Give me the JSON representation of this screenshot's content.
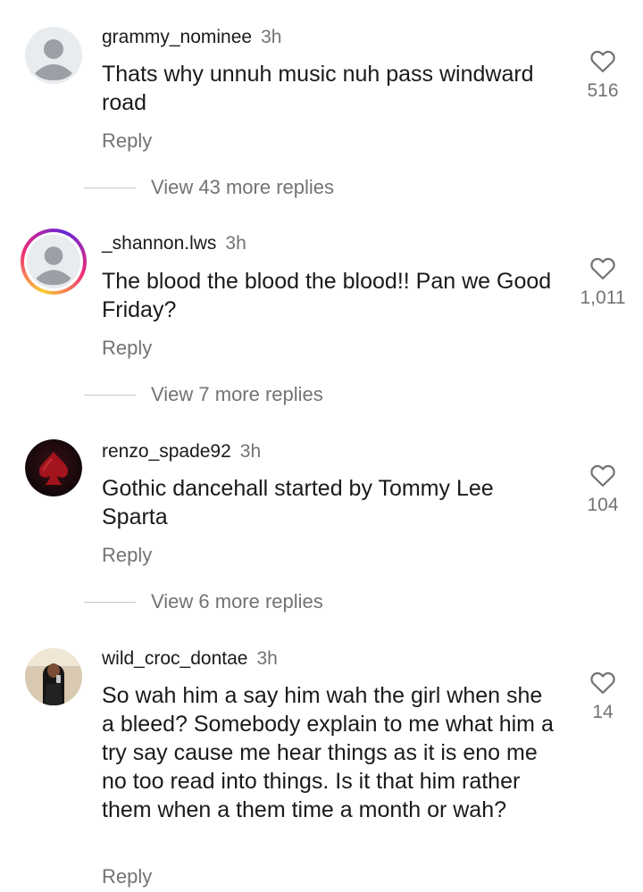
{
  "comments": [
    {
      "username": "grammy_nominee",
      "time": "3h",
      "text": "Thats why unnuh music nuh pass windward road",
      "likes": "516",
      "reply_label": "Reply",
      "view_replies": "View 43 more replies",
      "avatar_icon": "default-user-icon"
    },
    {
      "username": "_shannon.lws",
      "time": "3h",
      "text": "The blood the blood the blood!! Pan we Good Friday?",
      "likes": "1,011",
      "reply_label": "Reply",
      "view_replies": "View 7 more replies",
      "avatar_icon": "default-user-icon"
    },
    {
      "username": "renzo_spade92",
      "time": "3h",
      "text": "Gothic dancehall started by Tommy Lee Sparta",
      "likes": "104",
      "reply_label": "Reply",
      "view_replies": "View 6 more replies",
      "avatar_icon": "spade-photo"
    },
    {
      "username": "wild_croc_dontae",
      "time": "3h",
      "text": "So wah him a say him wah the girl when she a bleed? Somebody explain to me what him a try say cause me hear things as it is eno me no too read into things. Is it that him rather them when a them time a month or wah?",
      "likes": "14",
      "reply_label": "Reply",
      "avatar_icon": "user-photo"
    }
  ],
  "colors": {
    "text": "#1a1a1a",
    "secondary": "#737373",
    "avatar_bg": "#e9ecef",
    "avatar_fg": "#9aa0a6"
  }
}
